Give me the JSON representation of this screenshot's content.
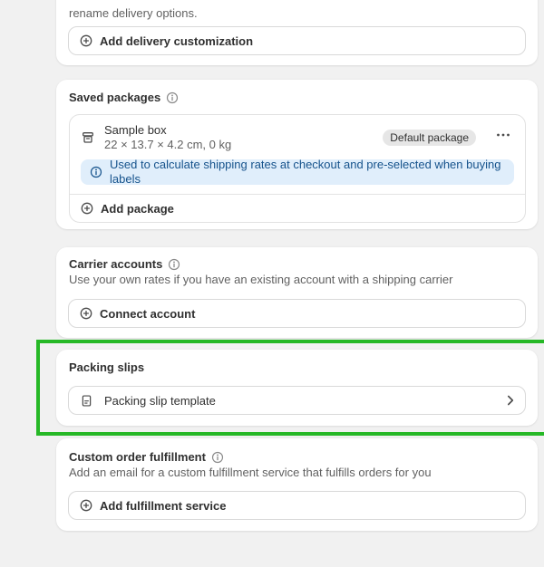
{
  "annotation": {
    "highlight_color": "#26b826"
  },
  "delivery_customization": {
    "intro_text": "rename delivery options.",
    "add_button_label": "Add delivery customization"
  },
  "saved_packages": {
    "title": "Saved packages",
    "package": {
      "name": "Sample box",
      "dimensions": "22 × 13.7 × 4.2 cm, 0 kg",
      "badge_label": "Default package"
    },
    "info_banner_text": "Used to calculate shipping rates at checkout and pre-selected when buying labels",
    "add_button_label": "Add package"
  },
  "carrier_accounts": {
    "title": "Carrier accounts",
    "description": "Use your own rates if you have an existing account with a shipping carrier",
    "connect_button_label": "Connect account"
  },
  "packing_slips": {
    "title": "Packing slips",
    "template_row_label": "Packing slip template"
  },
  "custom_order_fulfillment": {
    "title": "Custom order fulfillment",
    "description": "Add an email for a custom fulfillment service that fulfills orders for you",
    "add_button_label": "Add fulfillment service"
  }
}
